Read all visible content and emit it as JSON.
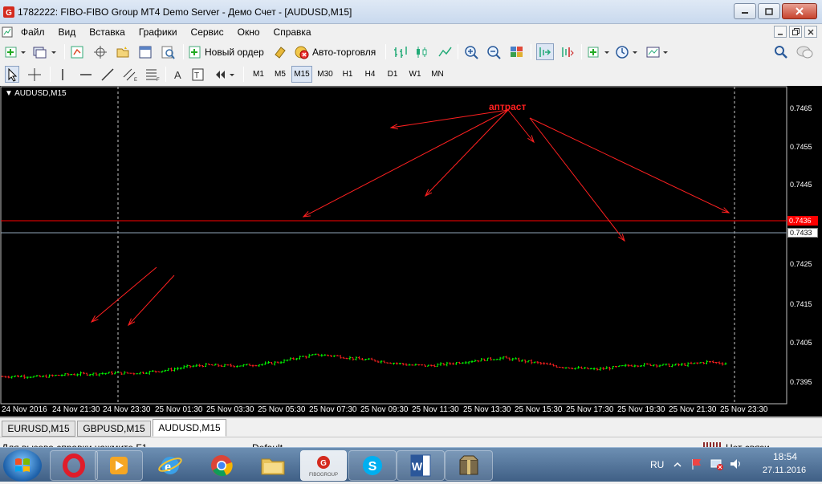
{
  "window": {
    "title": "1782222: FIBO-FIBO Group MT4 Demo Server - Демо Счет - [AUDUSD,M15]"
  },
  "menu": {
    "items": [
      "Файл",
      "Вид",
      "Вставка",
      "Графики",
      "Сервис",
      "Окно",
      "Справка"
    ]
  },
  "toolbar": {
    "new_order_label": "Новый ордер",
    "autotrading_label": "Авто-торговля"
  },
  "timeframes": [
    "M1",
    "M5",
    "M15",
    "M30",
    "H1",
    "H4",
    "D1",
    "W1",
    "MN"
  ],
  "active_timeframe": "M15",
  "chart": {
    "title": "AUDUSD,M15",
    "annotation": "аптраст",
    "price_axis": [
      "0.7465",
      "0.7455",
      "0.7445",
      "0.7425",
      "0.7415",
      "0.7405",
      "0.7395"
    ],
    "time_axis": [
      "24 Nov 2016",
      "24 Nov 21:30",
      "24 Nov 23:30",
      "25 Nov 01:30",
      "25 Nov 03:30",
      "25 Nov 05:30",
      "25 Nov 07:30",
      "25 Nov 09:30",
      "25 Nov 11:30",
      "25 Nov 13:30",
      "25 Nov 15:30",
      "25 Nov 17:30",
      "25 Nov 19:30",
      "25 Nov 21:30",
      "25 Nov 23:30"
    ],
    "level_red": "0.7436",
    "level_white": "0.7433",
    "colors": {
      "bull": "#00ff00",
      "bear": "#ff2020",
      "level_red": "#ff0000",
      "level_gray": "#8fa3b8",
      "background": "#000000"
    }
  },
  "tabs": [
    "EURUSD,M15",
    "GBPUSD,M15",
    "AUDUSD,M15"
  ],
  "active_tab": "AUDUSD,M15",
  "status": {
    "help": "Для вызова справки нажмите F1",
    "profile": "Default",
    "connection": "Нет связи"
  },
  "taskbar": {
    "apps": [
      "opera-icon",
      "media-player-icon",
      "internet-explorer-icon",
      "chrome-icon",
      "folder-icon",
      "fibo-group-icon",
      "skype-icon",
      "word-icon",
      "archive-icon"
    ],
    "fibo_label": "FIBOGROUP",
    "language": "RU",
    "time": "18:54",
    "date": "27.11.2016"
  }
}
